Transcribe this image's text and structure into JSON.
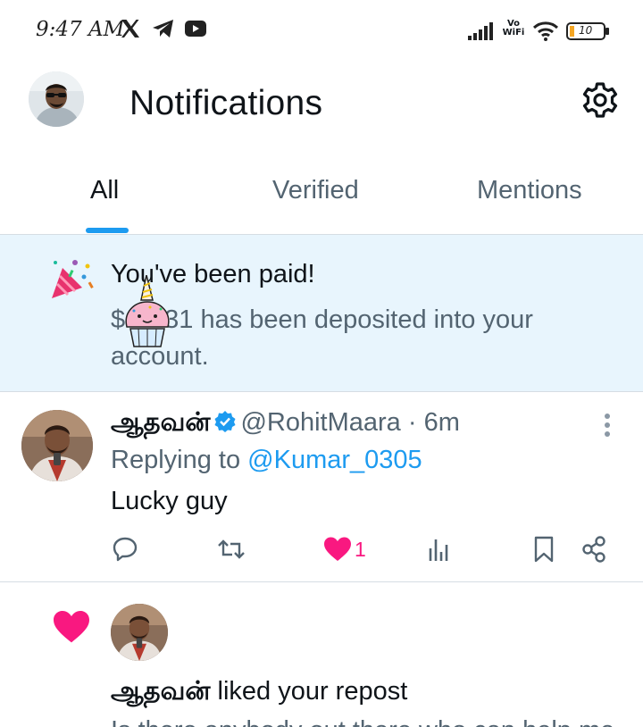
{
  "status_bar": {
    "time": "9:47 AM",
    "app_icons": [
      "x-icon",
      "telegram-icon",
      "youtube-icon"
    ],
    "network": "Vo WiFi",
    "battery": "10"
  },
  "header": {
    "title": "Notifications",
    "settings_icon": "gear-icon"
  },
  "tabs": [
    {
      "label": "All",
      "active": true
    },
    {
      "label": "Verified",
      "active": false
    },
    {
      "label": "Mentions",
      "active": false
    }
  ],
  "paid_banner": {
    "title": "You've been paid!",
    "body_prefix": "$",
    "body": "31 has been deposited into your account."
  },
  "reply": {
    "name": "ஆதவன்",
    "handle": "@RohitMaara",
    "time": "6m",
    "replying_label": "Replying to",
    "replying_to": "@Kumar_0305",
    "text": "Lucky guy",
    "like_count": "1"
  },
  "like_notification": {
    "name": "ஆதவன்",
    "action": "liked your repost",
    "preview": "Is there anybody out there who can help me find"
  },
  "colors": {
    "accent": "#1d9bf0",
    "like": "#f91880",
    "banner_bg": "#e8f5fd",
    "secondary_text": "#536471"
  }
}
